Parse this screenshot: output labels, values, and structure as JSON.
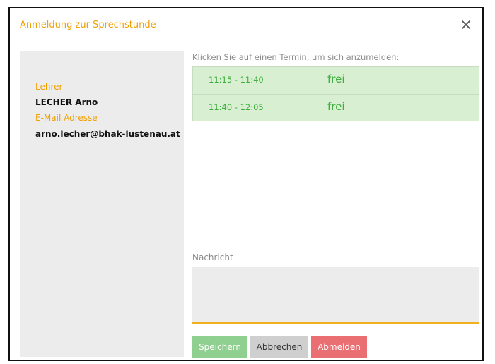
{
  "dialog": {
    "title": "Anmeldung zur Sprechstunde",
    "close_icon": "close-icon"
  },
  "sidebar": {
    "teacher_label": "Lehrer",
    "teacher_name": "LECHER Arno",
    "email_label": "E-Mail Adresse",
    "email": "arno.lecher@bhak-lustenau.at"
  },
  "slots": {
    "hint": "Klicken Sie auf einen Termin, um sich anzumelden:",
    "items": [
      {
        "time": "11:15 - 11:40",
        "status": "frei"
      },
      {
        "time": "11:40 - 12:05",
        "status": "frei"
      }
    ]
  },
  "message": {
    "label": "Nachricht",
    "value": "",
    "placeholder": ""
  },
  "buttons": {
    "save": "Speichern",
    "cancel": "Abbrechen",
    "logout": "Abmelden"
  },
  "colors": {
    "accent": "#f0a000",
    "slot_bg": "#d8efd1",
    "slot_text": "#3fae3f",
    "save": "#8fcf8f",
    "cancel": "#cfcfcf",
    "logout": "#ea6f72"
  }
}
